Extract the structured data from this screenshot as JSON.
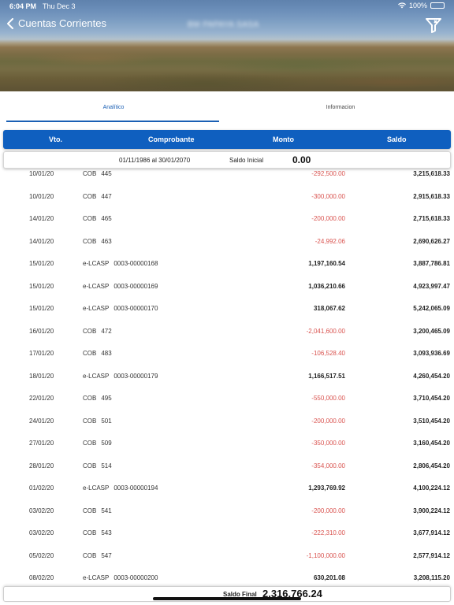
{
  "status": {
    "time": "6:04 PM",
    "date": "Thu Dec 3",
    "battery": "100%"
  },
  "nav": {
    "back_label": "Cuentas Corrientes",
    "subtitle": "BM PAPAYA SASA"
  },
  "tabs": [
    {
      "label": "Analítico",
      "selected": true
    },
    {
      "label": "Informacion",
      "selected": false
    }
  ],
  "table": {
    "headers": {
      "vto": "Vto.",
      "comprobante": "Comprobante",
      "monto": "Monto",
      "saldo": "Saldo"
    },
    "saldo_inicial": {
      "range": "01/11/1986 al 30/01/2070",
      "label": "Saldo Inicial",
      "value": "0.00"
    },
    "rows": [
      {
        "fecha": "10/01/20",
        "tipo": "COB",
        "nro": "445",
        "monto": "-292,500.00",
        "saldo": "3,215,618.33",
        "neg": true
      },
      {
        "fecha": "10/01/20",
        "tipo": "COB",
        "nro": "447",
        "monto": "-300,000.00",
        "saldo": "2,915,618.33",
        "neg": true
      },
      {
        "fecha": "14/01/20",
        "tipo": "COB",
        "nro": "465",
        "monto": "-200,000.00",
        "saldo": "2,715,618.33",
        "neg": true
      },
      {
        "fecha": "14/01/20",
        "tipo": "COB",
        "nro": "463",
        "monto": "-24,992.06",
        "saldo": "2,690,626.27",
        "neg": true
      },
      {
        "fecha": "15/01/20",
        "tipo": "e-LCASP",
        "nro": "0003-00000168",
        "monto": "1,197,160.54",
        "saldo": "3,887,786.81",
        "neg": false
      },
      {
        "fecha": "15/01/20",
        "tipo": "e-LCASP",
        "nro": "0003-00000169",
        "monto": "1,036,210.66",
        "saldo": "4,923,997.47",
        "neg": false
      },
      {
        "fecha": "15/01/20",
        "tipo": "e-LCASP",
        "nro": "0003-00000170",
        "monto": "318,067.62",
        "saldo": "5,242,065.09",
        "neg": false
      },
      {
        "fecha": "16/01/20",
        "tipo": "COB",
        "nro": "472",
        "monto": "-2,041,600.00",
        "saldo": "3,200,465.09",
        "neg": true
      },
      {
        "fecha": "17/01/20",
        "tipo": "COB",
        "nro": "483",
        "monto": "-106,528.40",
        "saldo": "3,093,936.69",
        "neg": true
      },
      {
        "fecha": "18/01/20",
        "tipo": "e-LCASP",
        "nro": "0003-00000179",
        "monto": "1,166,517.51",
        "saldo": "4,260,454.20",
        "neg": false
      },
      {
        "fecha": "22/01/20",
        "tipo": "COB",
        "nro": "495",
        "monto": "-550,000.00",
        "saldo": "3,710,454.20",
        "neg": true
      },
      {
        "fecha": "24/01/20",
        "tipo": "COB",
        "nro": "501",
        "monto": "-200,000.00",
        "saldo": "3,510,454.20",
        "neg": true
      },
      {
        "fecha": "27/01/20",
        "tipo": "COB",
        "nro": "509",
        "monto": "-350,000.00",
        "saldo": "3,160,454.20",
        "neg": true
      },
      {
        "fecha": "28/01/20",
        "tipo": "COB",
        "nro": "514",
        "monto": "-354,000.00",
        "saldo": "2,806,454.20",
        "neg": true
      },
      {
        "fecha": "01/02/20",
        "tipo": "e-LCASP",
        "nro": "0003-00000194",
        "monto": "1,293,769.92",
        "saldo": "4,100,224.12",
        "neg": false
      },
      {
        "fecha": "03/02/20",
        "tipo": "COB",
        "nro": "541",
        "monto": "-200,000.00",
        "saldo": "3,900,224.12",
        "neg": true
      },
      {
        "fecha": "03/02/20",
        "tipo": "COB",
        "nro": "543",
        "monto": "-222,310.00",
        "saldo": "3,677,914.12",
        "neg": true
      },
      {
        "fecha": "05/02/20",
        "tipo": "COB",
        "nro": "547",
        "monto": "-1,100,000.00",
        "saldo": "2,577,914.12",
        "neg": true
      },
      {
        "fecha": "08/02/20",
        "tipo": "e-LCASP",
        "nro": "0003-00000200",
        "monto": "630,201.08",
        "saldo": "3,208,115.20",
        "neg": false
      }
    ],
    "saldo_final": {
      "label": "Saldo Final",
      "value": "2,316,766.24"
    }
  },
  "colors": {
    "accent": "#0f5fbf",
    "negative": "#d9534f",
    "tab_active": "#1a5fb4"
  }
}
